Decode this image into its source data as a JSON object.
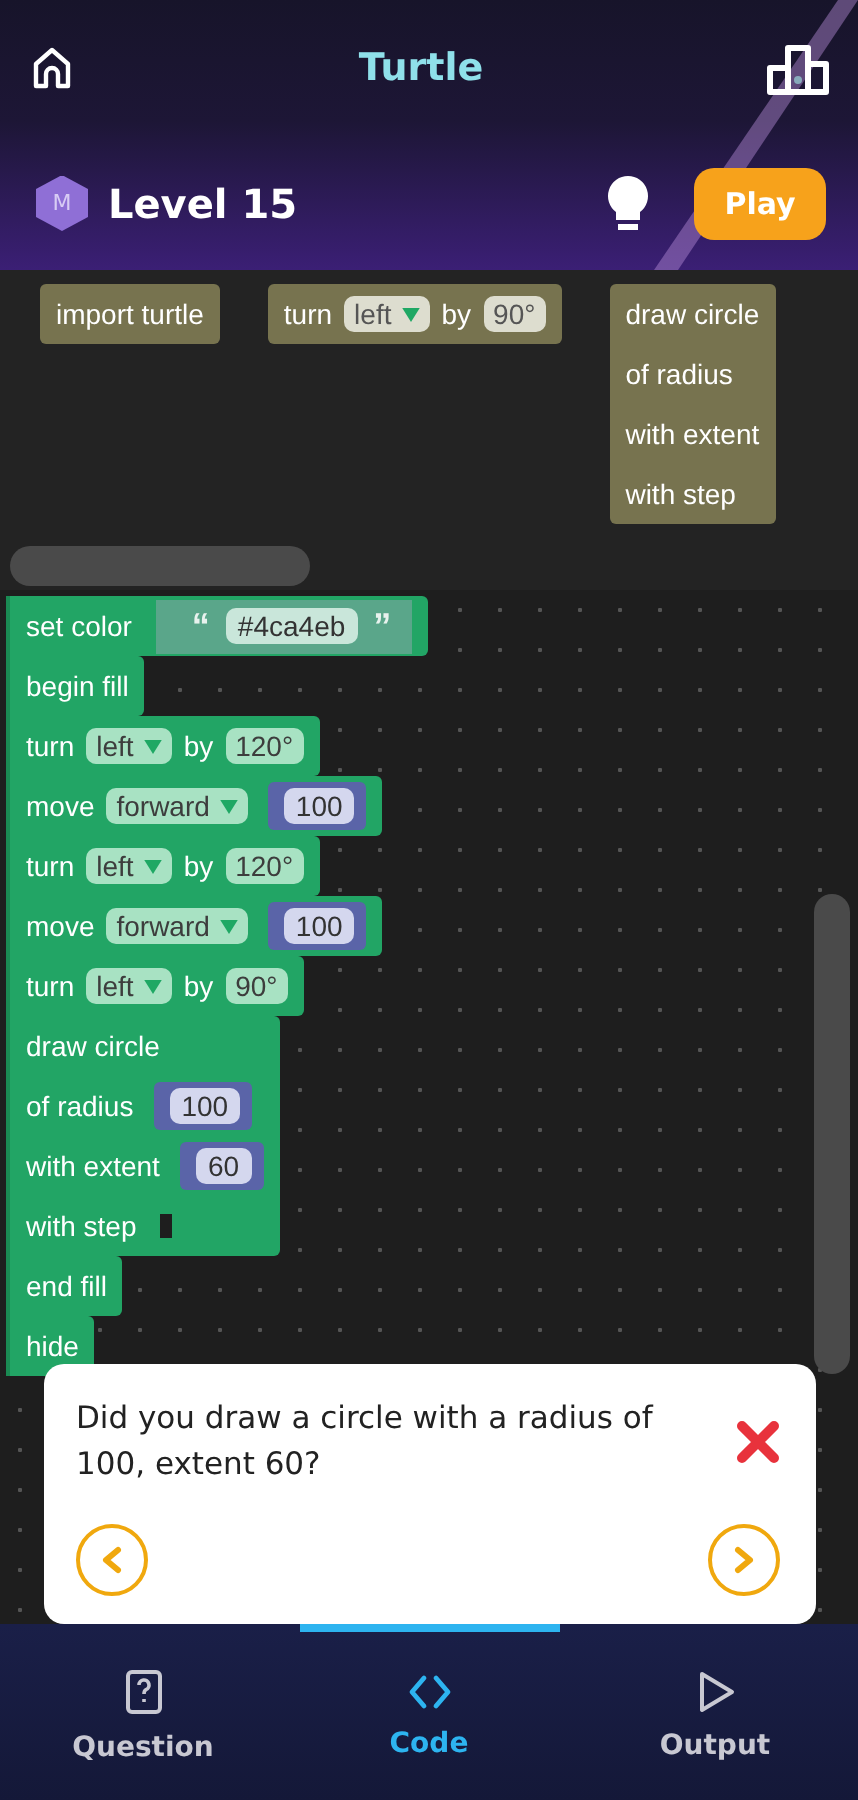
{
  "header": {
    "title": "Turtle"
  },
  "level_bar": {
    "badge": "M",
    "level": "Level 15",
    "play_button": "Play"
  },
  "toolbox": [
    {
      "lines": [
        [
          {
            "kind": "label",
            "text": "import turtle"
          }
        ]
      ]
    },
    {
      "lines": [
        [
          {
            "kind": "label",
            "text": "turn"
          },
          {
            "kind": "dropdown",
            "text": "left"
          },
          {
            "kind": "label",
            "text": "by"
          },
          {
            "kind": "number",
            "text": "90°"
          }
        ]
      ]
    },
    {
      "lines": [
        [
          {
            "kind": "label",
            "text": "draw circle"
          }
        ],
        [
          {
            "kind": "label",
            "text": "of radius"
          }
        ],
        [
          {
            "kind": "label",
            "text": "with extent"
          }
        ],
        [
          {
            "kind": "label",
            "text": "with step"
          }
        ]
      ]
    }
  ],
  "workspace": [
    {
      "lines": [
        [
          {
            "kind": "label",
            "text": "set color"
          },
          {
            "kind": "string",
            "open": "“",
            "text": "#4ca4eb",
            "close": "”"
          }
        ]
      ]
    },
    {
      "lines": [
        [
          {
            "kind": "label",
            "text": "begin fill"
          }
        ]
      ]
    },
    {
      "lines": [
        [
          {
            "kind": "label",
            "text": "turn"
          },
          {
            "kind": "dropdown",
            "text": "left"
          },
          {
            "kind": "label",
            "text": "by"
          },
          {
            "kind": "number",
            "text": "120°"
          }
        ]
      ]
    },
    {
      "lines": [
        [
          {
            "kind": "label",
            "text": "move"
          },
          {
            "kind": "dropdown",
            "text": "forward"
          },
          {
            "kind": "value",
            "text": "100"
          }
        ]
      ]
    },
    {
      "lines": [
        [
          {
            "kind": "label",
            "text": "turn"
          },
          {
            "kind": "dropdown",
            "text": "left"
          },
          {
            "kind": "label",
            "text": "by"
          },
          {
            "kind": "number",
            "text": "120°"
          }
        ]
      ]
    },
    {
      "lines": [
        [
          {
            "kind": "label",
            "text": "move"
          },
          {
            "kind": "dropdown",
            "text": "forward"
          },
          {
            "kind": "value",
            "text": "100"
          }
        ]
      ]
    },
    {
      "lines": [
        [
          {
            "kind": "label",
            "text": "turn"
          },
          {
            "kind": "dropdown",
            "text": "left"
          },
          {
            "kind": "label",
            "text": "by"
          },
          {
            "kind": "number",
            "text": "90°"
          }
        ]
      ]
    },
    {
      "lines": [
        [
          {
            "kind": "label",
            "text": "draw circle"
          }
        ],
        [
          {
            "kind": "label",
            "text": "of radius"
          },
          {
            "kind": "value",
            "text": "100"
          }
        ],
        [
          {
            "kind": "label",
            "text": "with extent"
          },
          {
            "kind": "value",
            "text": "60"
          }
        ],
        [
          {
            "kind": "label",
            "text": "with step"
          },
          {
            "kind": "socket"
          }
        ]
      ]
    },
    {
      "lines": [
        [
          {
            "kind": "label",
            "text": "end fill"
          }
        ]
      ]
    },
    {
      "lines": [
        [
          {
            "kind": "label",
            "text": "hide"
          }
        ]
      ]
    }
  ],
  "hint_dialog": {
    "text": "Did you draw a circle with a radius of 100, extent 60?"
  },
  "bottom_nav": [
    {
      "kind": "question",
      "label": "Question",
      "selected": false
    },
    {
      "kind": "code",
      "label": "Code",
      "selected": true
    },
    {
      "kind": "output",
      "label": "Output",
      "selected": false
    }
  ]
}
